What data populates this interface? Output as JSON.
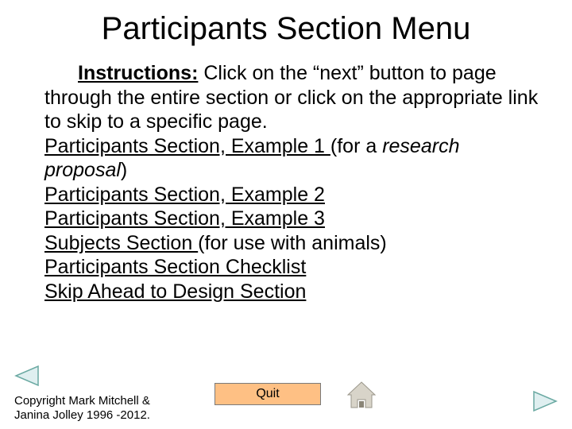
{
  "title": "Participants Section Menu",
  "instructions": {
    "label": "Instructions:",
    "text": " Click on the “next” button to page through the entire section or click on the appropriate link to skip to a specific page."
  },
  "links": {
    "example1": {
      "label": "Participants Section, Example 1 ",
      "note_prefix": "(for a ",
      "note_italic": "research proposal",
      "note_suffix": ")"
    },
    "example2": "Participants Section, Example 2",
    "example3": "Participants Section, Example 3",
    "subjects": {
      "label": "Subjects Section ",
      "note": "(for use with animals)"
    },
    "checklist": "Participants Section Checklist",
    "skip": "Skip Ahead to Design Section"
  },
  "footer": {
    "copyright_l1": "Copyright Mark Mitchell &",
    "copyright_l2": "Janina Jolley 1996 -2012.",
    "quit": "Quit"
  },
  "icons": {
    "prev": "previous-arrow-icon",
    "next": "next-arrow-icon",
    "home": "home-icon"
  }
}
